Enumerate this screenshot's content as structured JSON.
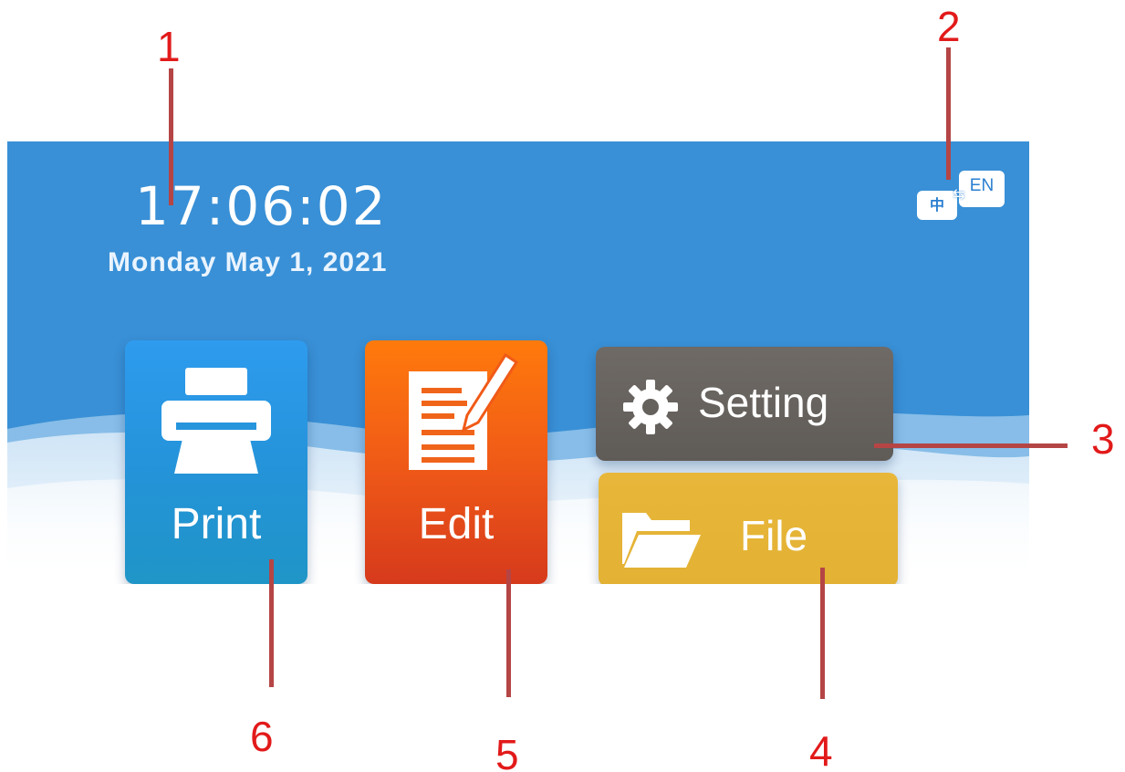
{
  "status": {
    "time": "17:06:02",
    "date": "Monday May 1, 2021"
  },
  "language": {
    "left_label": "中",
    "right_label": "EN",
    "link_glyph": "⇆",
    "icon": "language-switch-icon"
  },
  "tiles": {
    "print": {
      "label": "Print",
      "icon": "printer-icon",
      "color": "#2493d8"
    },
    "edit": {
      "label": "Edit",
      "icon": "document-edit-icon",
      "color": "#f05a17"
    },
    "setting": {
      "label": "Setting",
      "icon": "gear-icon",
      "color": "#65615d"
    },
    "file": {
      "label": "File",
      "icon": "folder-open-icon",
      "color": "#e3b133"
    }
  },
  "colors": {
    "screen_background": "#3990d6",
    "callout_number": "#e21a1a",
    "callout_line": "#b54545"
  },
  "callouts": [
    "1",
    "2",
    "3",
    "4",
    "5",
    "6"
  ]
}
